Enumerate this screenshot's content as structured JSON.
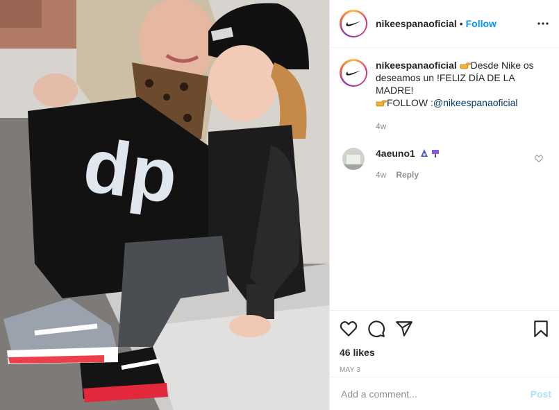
{
  "post": {
    "username": "nikeespanaoficial",
    "separator": "•",
    "follow_label": "Follow"
  },
  "caption": {
    "username": "nikeespanaoficial",
    "line1": "Desde Nike os deseamos un !FELIZ DÍA DE LA MADRE!",
    "follow_prefix": "FOLLOW :",
    "mention": "@nikeespanaoficial",
    "time": "4w"
  },
  "comment": {
    "username": "4aeuno1",
    "time": "4w",
    "reply_label": "Reply"
  },
  "stats": {
    "likes": "46 likes",
    "date": "MAY 3"
  },
  "add_comment": {
    "placeholder": "Add a comment...",
    "post_label": "Post"
  },
  "icons": {
    "more": "more-options-icon",
    "like": "heart-icon",
    "comment": "comment-icon",
    "share": "share-icon",
    "save": "bookmark-icon",
    "pointing_hand": "pointing-hand-emoji"
  },
  "colors": {
    "link": "#0095f6",
    "mention": "#00376b",
    "muted": "#8e8e8e",
    "text": "#262626",
    "post_disabled": "#b2dffc"
  }
}
